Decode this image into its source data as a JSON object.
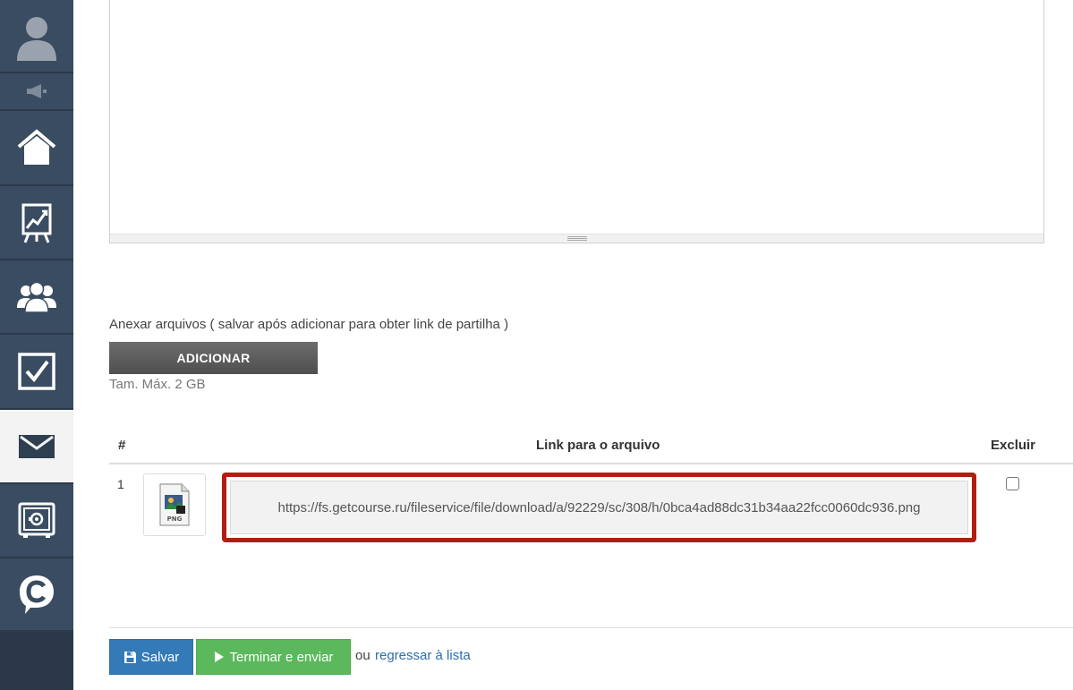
{
  "sidebar": {
    "items": [
      {
        "name": "avatar",
        "icon": "user-avatar-icon"
      },
      {
        "name": "announcements",
        "icon": "megaphone-icon"
      },
      {
        "name": "home",
        "icon": "home-icon"
      },
      {
        "name": "statistics",
        "icon": "chart-board-icon"
      },
      {
        "name": "users",
        "icon": "users-icon"
      },
      {
        "name": "tasks",
        "icon": "checkbox-icon"
      },
      {
        "name": "messages",
        "icon": "envelope-icon",
        "active": true
      },
      {
        "name": "safe",
        "icon": "safe-icon"
      },
      {
        "name": "chat",
        "icon": "chat-c-icon"
      }
    ],
    "colors": {
      "background": "#3a4c61",
      "active": "#f3f3f3"
    }
  },
  "attachments": {
    "label": "Anexar arquivos ( salvar após adicionar para obter link de partilha )",
    "add_button": "ADICIONAR",
    "max_size": "Tam. Máx. 2 GB"
  },
  "table": {
    "headers": {
      "num": "#",
      "link": "Link para o arquivo",
      "delete": "Excluir"
    },
    "rows": [
      {
        "num": "1",
        "file_type": "PNG",
        "link": "https://fs.getcourse.ru/fileservice/file/download/a/92229/sc/308/h/0bca4ad88dc31b34aa22fcc0060dc936.png",
        "delete_checked": false
      }
    ]
  },
  "actions": {
    "save": "Salvar",
    "finish_send": "Terminar e enviar",
    "or": "ou",
    "back_link": "regressar à lista"
  },
  "colors": {
    "highlight_border": "#b01e0f",
    "save": "#337ab7",
    "send": "#5cb85c",
    "link": "#2a6fb0"
  }
}
